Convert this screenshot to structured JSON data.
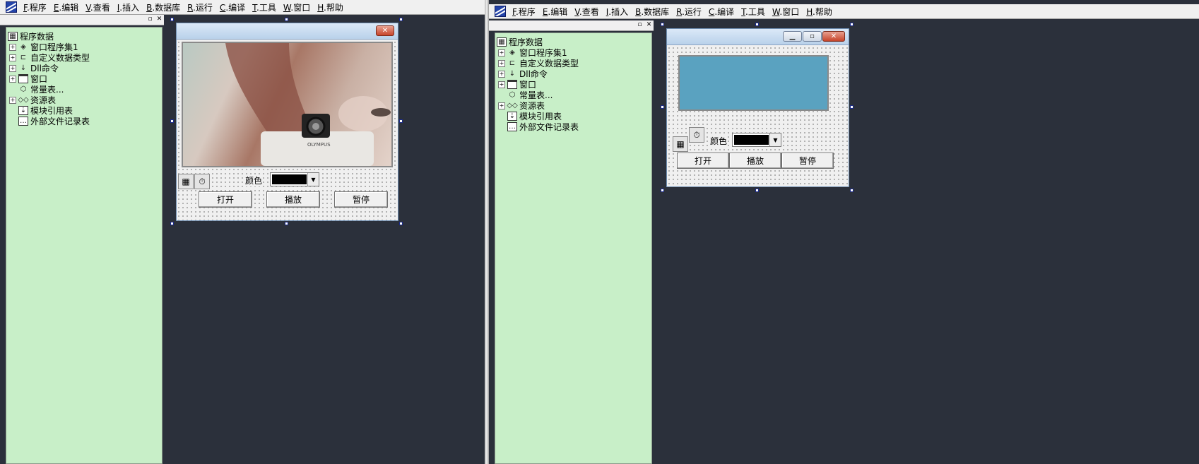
{
  "menu": [
    "F.程序",
    "E.编辑",
    "V.查看",
    "I.插入",
    "B.数据库",
    "R.运行",
    "C.编译",
    "T.工具",
    "W.窗口",
    "H.帮助"
  ],
  "tree": {
    "root": "程序数据",
    "items": [
      {
        "label": "窗口程序集1",
        "expand": true,
        "icon": "window-assembly-icon"
      },
      {
        "label": "自定义数据类型",
        "expand": true,
        "icon": "custom-type-icon"
      },
      {
        "label": "Dll命令",
        "expand": true,
        "icon": "dll-command-icon"
      },
      {
        "label": "窗口",
        "expand": true,
        "icon": "window-icon"
      },
      {
        "label": "常量表...",
        "expand": false,
        "icon": "constant-table-icon"
      },
      {
        "label": "资源表",
        "expand": true,
        "icon": "resource-table-icon"
      },
      {
        "label": "模块引用表",
        "expand": false,
        "icon": "module-ref-icon"
      },
      {
        "label": "外部文件记录表",
        "expand": false,
        "icon": "external-file-icon"
      }
    ]
  },
  "form": {
    "color_label": "颜色",
    "color_value": "#000000",
    "open_button": "打开",
    "play_button": "播放",
    "pause_button": "暂停"
  },
  "watermark_text": "OLYMPUS",
  "colors": {
    "tree_bg": "#c8efc8",
    "workspace_bg": "#2b303b",
    "video_panel": "#5aa2c0"
  }
}
